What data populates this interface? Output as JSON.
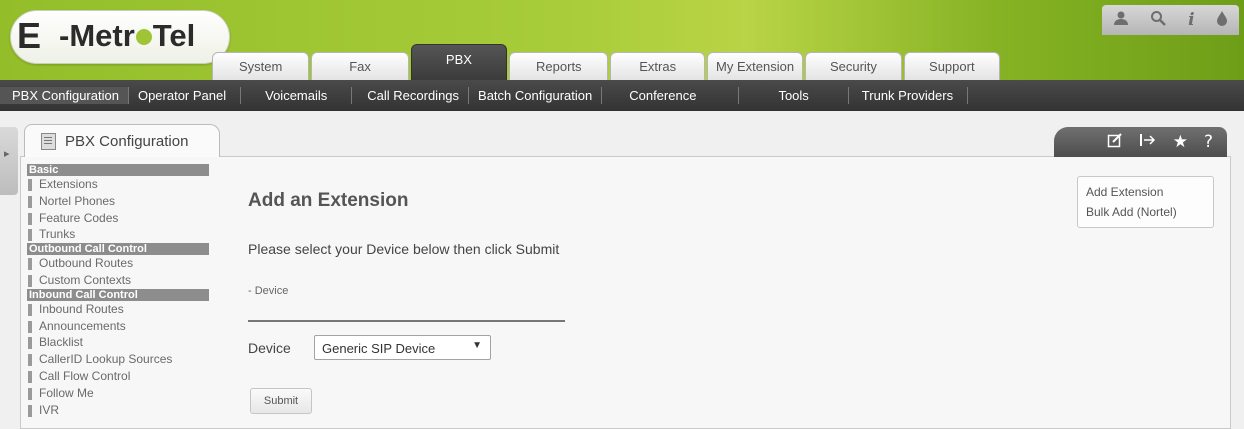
{
  "logo": {
    "e": "E",
    "name_pre": "-Metr",
    "name_post": "Tel"
  },
  "utility_icons": [
    "user-icon",
    "search-icon",
    "info-icon",
    "drop-icon"
  ],
  "tabs": [
    {
      "label": "System",
      "active": false
    },
    {
      "label": "Fax",
      "active": false
    },
    {
      "label": "PBX",
      "active": true
    },
    {
      "label": "Reports",
      "active": false
    },
    {
      "label": "Extras",
      "active": false
    },
    {
      "label": "My Extension",
      "active": false
    },
    {
      "label": "Security",
      "active": false
    },
    {
      "label": "Support",
      "active": false
    }
  ],
  "subnav": [
    {
      "label": "PBX Configuration",
      "active": true
    },
    {
      "label": "Operator Panel"
    },
    {
      "label": "Voicemails"
    },
    {
      "label": "Call Recordings"
    },
    {
      "label": "Batch Configuration"
    },
    {
      "label": "Conference"
    },
    {
      "label": "Tools"
    },
    {
      "label": "Trunk Providers"
    }
  ],
  "panel": {
    "title": "PBX Configuration"
  },
  "tool_icons": [
    "edit-icon",
    "pin-icon",
    "star-icon",
    "help-icon"
  ],
  "sidebar": {
    "sections": [
      {
        "title": "Basic",
        "items": [
          "Extensions",
          "Nortel Phones",
          "Feature Codes",
          "Trunks"
        ]
      },
      {
        "title": "Outbound Call Control",
        "items": [
          "Outbound Routes",
          "Custom Contexts"
        ]
      },
      {
        "title": "Inbound Call Control",
        "items": [
          "Inbound Routes",
          "Announcements",
          "Blacklist",
          "CallerID Lookup Sources",
          "Call Flow Control",
          "Follow Me",
          "IVR"
        ]
      }
    ]
  },
  "main": {
    "heading": "Add an Extension",
    "instruction": "Please select your Device below then click Submit",
    "section_label": "- Device",
    "device_label": "Device",
    "device_value": "Generic SIP Device",
    "submit_label": "Submit"
  },
  "right_links": [
    "Add Extension",
    "Bulk Add (Nortel)"
  ]
}
